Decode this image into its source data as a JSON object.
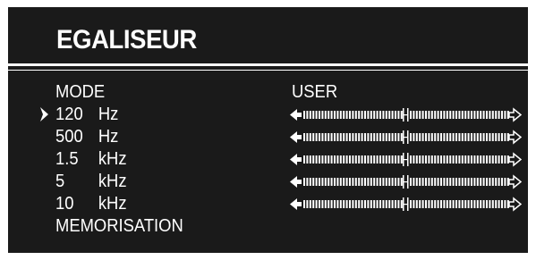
{
  "screen": {
    "title": "EGALISEUR",
    "background": "#1a1a1a",
    "foreground": "#ffffff"
  },
  "menu": {
    "mode": {
      "label": "MODE",
      "value": "USER"
    },
    "bands": [
      {
        "freq": "120",
        "unit": "Hz",
        "level": 0.5,
        "selected": true
      },
      {
        "freq": "500",
        "unit": "Hz",
        "level": 0.5,
        "selected": false
      },
      {
        "freq": "1.5",
        "unit": "kHz",
        "level": 0.5,
        "selected": false
      },
      {
        "freq": "5",
        "unit": "kHz",
        "level": 0.5,
        "selected": false
      },
      {
        "freq": "10",
        "unit": "kHz",
        "level": 0.5,
        "selected": false
      }
    ],
    "save_label": "MEMORISATION"
  },
  "icons": {
    "cursor": "pointer-arrow-icon",
    "slider_left": "arrow-left-icon",
    "slider_right": "arrow-right-icon"
  }
}
